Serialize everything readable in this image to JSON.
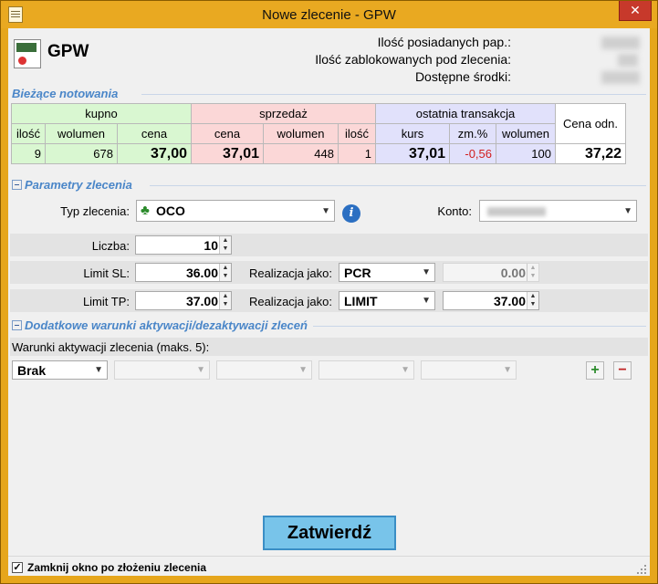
{
  "window": {
    "title": "Nowe zlecenie - GPW",
    "close": "✕"
  },
  "header": {
    "symbol": "GPW",
    "rows": [
      {
        "label": "Ilość posiadanych pap.:"
      },
      {
        "label": "Ilość zablokowanych pod zlecenia:"
      },
      {
        "label": "Dostępne środki:"
      }
    ]
  },
  "quotes": {
    "section_title": "Bieżące notowania",
    "groups": {
      "buy": "kupno",
      "sell": "sprzedaż",
      "last": "ostatnia transakcja",
      "ref": "Cena odn."
    },
    "columns": {
      "buy_qty": "ilość",
      "buy_vol": "wolumen",
      "buy_price": "cena",
      "sell_price": "cena",
      "sell_vol": "wolumen",
      "sell_qty": "ilość",
      "last_rate": "kurs",
      "last_change": "zm.%",
      "last_vol": "wolumen"
    },
    "values": {
      "buy_qty": "9",
      "buy_vol": "678",
      "buy_price": "37,00",
      "sell_price": "37,01",
      "sell_vol": "448",
      "sell_qty": "1",
      "last_rate": "37,01",
      "last_change": "-0,56",
      "last_vol": "100",
      "ref_price": "37,22"
    }
  },
  "params": {
    "section_title": "Parametry zlecenia",
    "order_type_label": "Typ zlecenia:",
    "order_type_value": "OCO",
    "account_label": "Konto:",
    "quantity_label": "Liczba:",
    "quantity_value": "10",
    "limit_sl_label": "Limit SL:",
    "limit_sl_value": "36.00",
    "realization_label": "Realizacja jako:",
    "sl_realization_value": "PCR",
    "sl_price_value": "0.00",
    "limit_tp_label": "Limit TP:",
    "limit_tp_value": "37.00",
    "tp_realization_value": "LIMIT",
    "tp_price_value": "37.00"
  },
  "conditions": {
    "section_title": "Dodatkowe warunki aktywacji/dezaktywacji zleceń",
    "activation_label": "Warunki aktywacji zlecenia (maks. 5):",
    "first_select_value": "Brak",
    "add": "+",
    "remove": "−"
  },
  "footer": {
    "submit_label": "Zatwierdź",
    "close_after_label": "Zamknij okno po złożeniu zlecenia",
    "close_after_checked": "✓"
  }
}
